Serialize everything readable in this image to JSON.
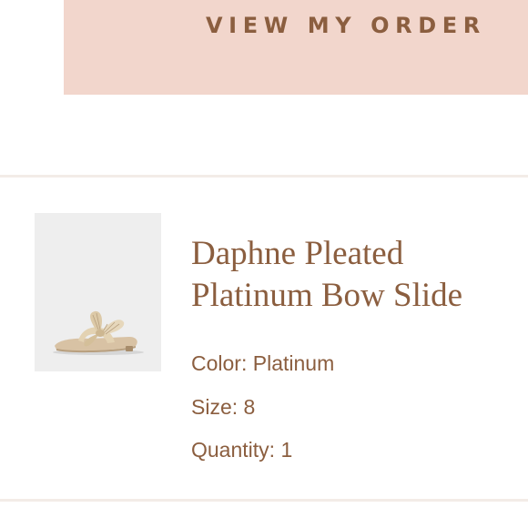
{
  "banner": {
    "label": "VIEW MY ORDER"
  },
  "item": {
    "title": "Daphne Pleated Platinum Bow Slide",
    "color_label": "Color:",
    "color_value": "Platinum",
    "size_label": "Size:",
    "size_value": "8",
    "quantity_label": "Quantity:",
    "quantity_value": "1"
  },
  "colors": {
    "banner_bg": "#f2d6cc",
    "accent_text": "#8b5e3f",
    "divider": "#f3ece7",
    "thumbnail_bg": "#eeeeee"
  }
}
